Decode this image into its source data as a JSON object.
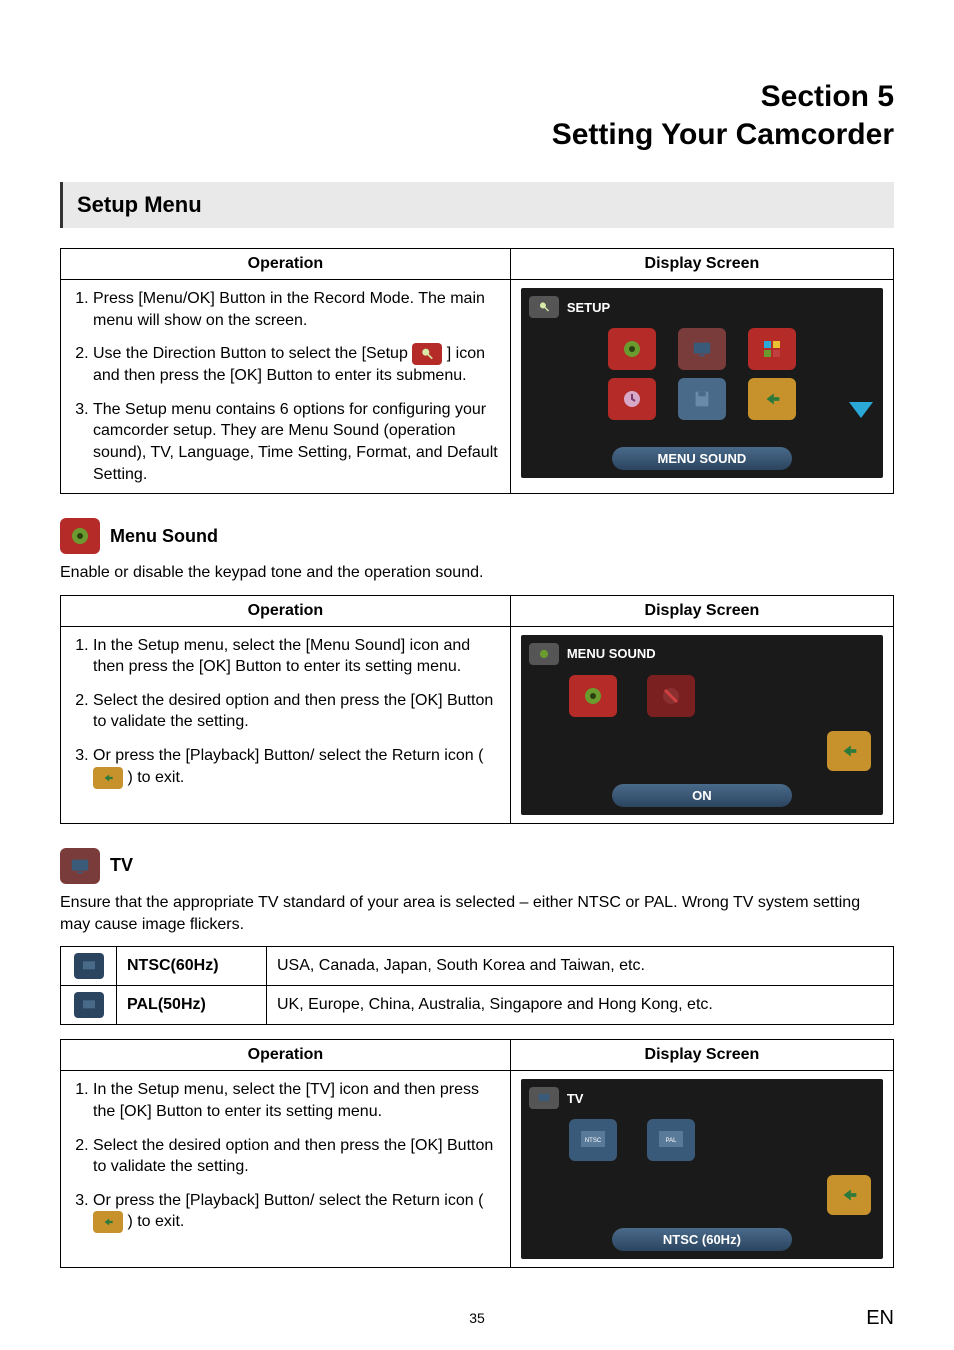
{
  "header": {
    "line1": "Section 5",
    "line2": "Setting Your Camcorder"
  },
  "bar": {
    "title": "Setup Menu"
  },
  "table1": {
    "head_op": "Operation",
    "head_ds": "Display Screen",
    "items": [
      "Press [Menu/OK] Button in the Record Mode. The main menu will show on the screen.",
      "Use the Direction Button to select the [Setup ] icon and then press the [OK] Button to enter its submenu.",
      "The Setup menu contains 6 options for configuring your camcorder setup. They are Menu Sound (operation sound), TV, Language, Time Setting, Format, and Default Setting."
    ],
    "screen_title": "SETUP",
    "screen_footer": "MENU SOUND"
  },
  "menu_sound": {
    "label": "Menu Sound",
    "desc": "Enable or disable the keypad tone and the operation sound.",
    "head_op": "Operation",
    "head_ds": "Display Screen",
    "items": [
      "In the Setup menu, select the [Menu Sound] icon and then press the [OK] Button to enter its setting menu.",
      "Select the desired option and then press the [OK] Button to validate the setting.",
      "Or press the [Playback] Button/ select the Return icon ( ) to exit."
    ],
    "screen_title": "MENU SOUND",
    "screen_footer": "ON"
  },
  "tv": {
    "label": "TV",
    "desc": "Ensure that the appropriate TV standard of your area is selected – either NTSC or PAL. Wrong TV system setting may cause image flickers.",
    "rows": [
      {
        "name": "NTSC(60Hz)",
        "text": "USA, Canada, Japan, South Korea and Taiwan, etc."
      },
      {
        "name": "PAL(50Hz)",
        "text": "UK, Europe, China, Australia, Singapore and Hong Kong, etc."
      }
    ],
    "head_op": "Operation",
    "head_ds": "Display Screen",
    "items": [
      "In the Setup menu, select the [TV] icon and then press the [OK] Button to enter its setting menu.",
      "Select the desired option and then press the [OK] Button to validate the setting.",
      "Or press the [Playback] Button/ select the Return icon ( ) to exit."
    ],
    "screen_title": "TV",
    "screen_footer": "NTSC (60Hz)"
  },
  "page": {
    "num": "35",
    "lang": "EN"
  },
  "icons": {
    "speaker": "speaker-icon",
    "tv": "tv-icon",
    "settings": "settings-icon",
    "clock": "clock-icon",
    "format": "format-icon",
    "return": "return-icon",
    "ntsc": "ntsc-icon",
    "pal": "pal-icon",
    "wrench": "wrench-icon"
  }
}
